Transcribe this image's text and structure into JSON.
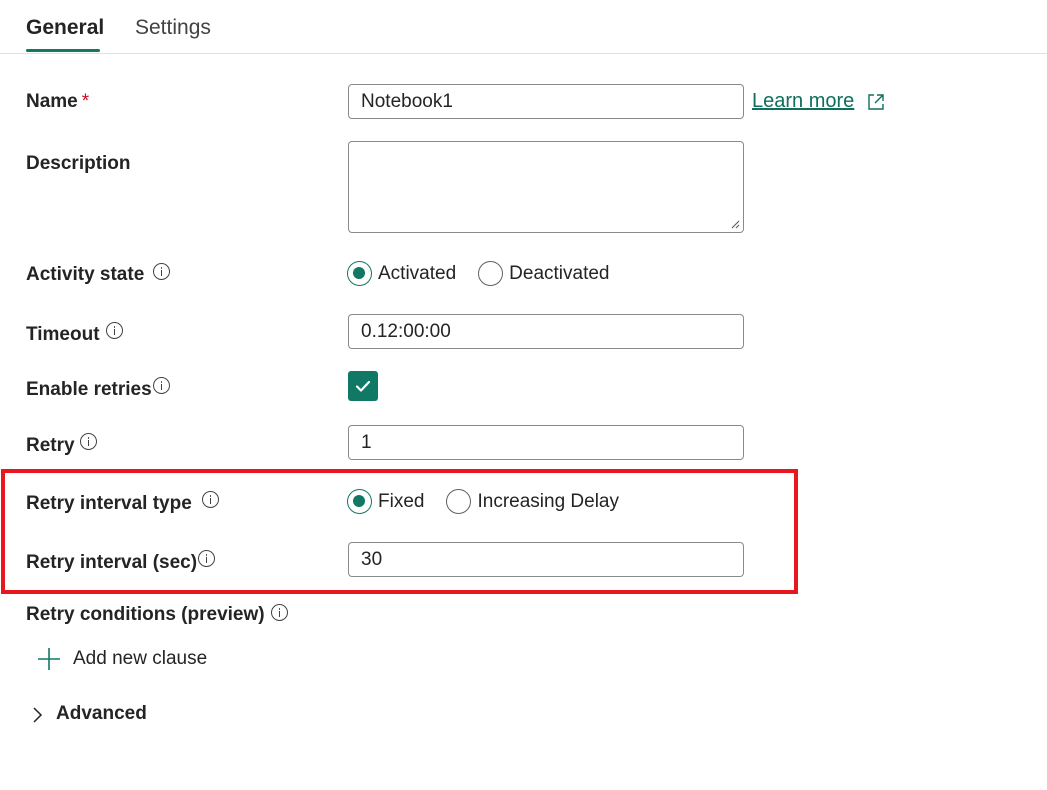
{
  "tabs": [
    {
      "label": "General",
      "active": true
    },
    {
      "label": "Settings",
      "active": false
    }
  ],
  "fields": {
    "name": {
      "label": "Name",
      "required_mark": "*",
      "value": "Notebook1",
      "learn_more": "Learn more"
    },
    "description": {
      "label": "Description",
      "value": ""
    },
    "activity_state": {
      "label": "Activity state",
      "options": [
        "Activated",
        "Deactivated"
      ],
      "selected": "Activated"
    },
    "timeout": {
      "label": "Timeout",
      "value": "0.12:00:00"
    },
    "enable_retries": {
      "label": "Enable retries",
      "checked": true
    },
    "retry": {
      "label": "Retry",
      "value": "1"
    },
    "retry_interval_type": {
      "label": "Retry interval type",
      "options": [
        "Fixed",
        "Increasing Delay"
      ],
      "selected": "Fixed"
    },
    "retry_interval": {
      "label": "Retry interval (sec)",
      "value": "30"
    },
    "retry_conditions": {
      "label": "Retry conditions (preview)",
      "add_label": "Add new clause"
    }
  },
  "advanced": {
    "label": "Advanced"
  },
  "colors": {
    "accent": "#117865",
    "highlight": "#e8171f",
    "required": "#c50f1f"
  },
  "icons": [
    "info-icon",
    "external-link-icon",
    "checkmark-icon",
    "plus-icon",
    "chevron-right-icon",
    "resize-grip-icon"
  ]
}
